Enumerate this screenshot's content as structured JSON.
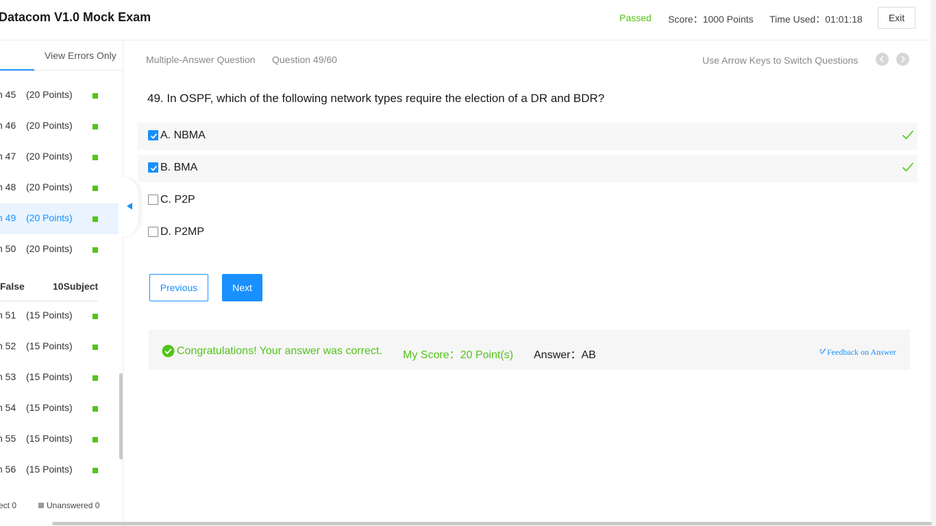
{
  "header": {
    "title": "Datacom V1.0 Mock Exam",
    "status": "Passed",
    "score_label": "Score：",
    "score_value": "1000 Points",
    "time_label": "Time Used：",
    "time_value": "01:01:18",
    "exit_label": "Exit"
  },
  "sidebar": {
    "tab_errors": "View Errors Only",
    "group1": [
      {
        "label": "n 45",
        "points": "(20 Points)"
      },
      {
        "label": "n 46",
        "points": "(20 Points)"
      },
      {
        "label": "n 47",
        "points": "(20 Points)"
      },
      {
        "label": "n 48",
        "points": "(20 Points)"
      },
      {
        "label": "n 49",
        "points": "(20 Points)"
      },
      {
        "label": "n 50",
        "points": "(20 Points)"
      }
    ],
    "section": {
      "type": "False",
      "count": "10Subject"
    },
    "group2": [
      {
        "label": "n 51",
        "points": "(15 Points)"
      },
      {
        "label": "n 52",
        "points": "(15 Points)"
      },
      {
        "label": "n 53",
        "points": "(15 Points)"
      },
      {
        "label": "n 54",
        "points": "(15 Points)"
      },
      {
        "label": "n 55",
        "points": "(15 Points)"
      },
      {
        "label": "n 56",
        "points": "(15 Points)"
      }
    ],
    "legend": {
      "correct": "ect 0",
      "unanswered": "Unanswered 0"
    }
  },
  "question": {
    "type": "Multiple-Answer Question",
    "number": "Question 49/60",
    "nav_hint": "Use Arrow Keys to Switch Questions",
    "text": "49. In OSPF, which of the following network types require the election of a DR and BDR?",
    "options": [
      {
        "label": "A. NBMA",
        "checked": true,
        "correct": true
      },
      {
        "label": "B. BMA",
        "checked": true,
        "correct": true
      },
      {
        "label": "C. P2P",
        "checked": false,
        "correct": false
      },
      {
        "label": "D. P2MP",
        "checked": false,
        "correct": false
      }
    ],
    "prev_label": "Previous",
    "next_label": "Next"
  },
  "result": {
    "message": "Congratulations! Your answer was correct.",
    "my_score": "My Score：20 Point(s)",
    "answer": "Answer：AB",
    "feedback": "Feedback on Answer"
  },
  "colors": {
    "accent": "#1890ff",
    "success": "#52c41a",
    "active_bg": "#e9f4ff"
  }
}
